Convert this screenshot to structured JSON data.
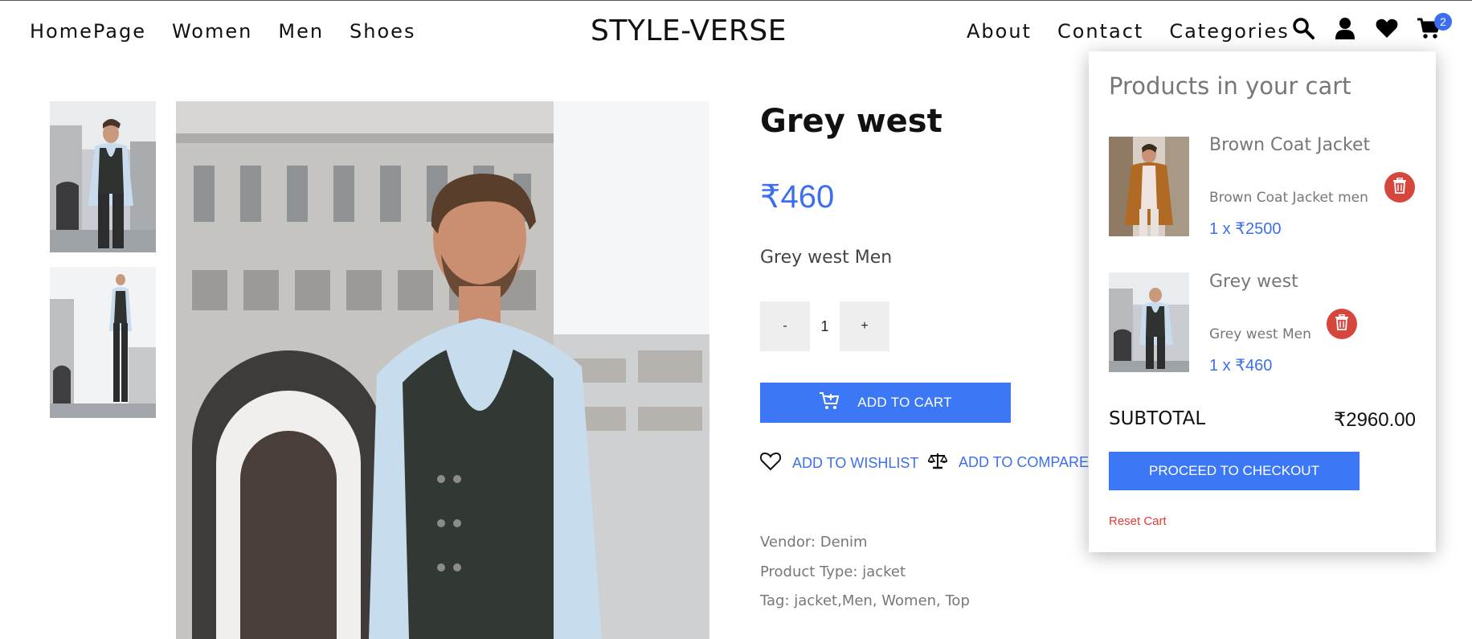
{
  "nav": {
    "brand": "STYLE-VERSE",
    "left_links": [
      "HomePage",
      "Women",
      "Men",
      "Shoes"
    ],
    "right_links": [
      "About",
      "Contact",
      "Categories"
    ],
    "icons": [
      "search-icon",
      "user-icon",
      "heart-icon",
      "cart-icon"
    ],
    "cart_count": "2"
  },
  "product": {
    "title": "Grey west",
    "price": "₹460",
    "subtitle": "Grey west Men",
    "quantity": "1",
    "minus_label": "-",
    "plus_label": "+",
    "add_to_cart": "ADD TO CART",
    "add_to_wishlist": "ADD TO WISHLIST",
    "add_to_compare": "ADD TO COMPARE",
    "vendor": "Vendor: Denim",
    "product_type": "Product Type: jacket",
    "tags": "Tag: jacket,Men, Women, Top"
  },
  "cart": {
    "title": "Products in your cart",
    "items": [
      {
        "name": "Brown Coat Jacket",
        "desc": "Brown Coat Jacket men",
        "price": "1 x ₹2500"
      },
      {
        "name": "Grey west",
        "desc": "Grey west Men",
        "price": "1 x ₹460"
      }
    ],
    "subtotal_label": "SUBTOTAL",
    "subtotal_value": "₹2960.00",
    "checkout_label": "PROCEED TO CHECKOUT",
    "reset_label": "Reset Cart"
  },
  "colors": {
    "accent": "#3c78f5",
    "price": "#3c6ff0",
    "delete": "#d6463c",
    "reset": "#e53935"
  }
}
